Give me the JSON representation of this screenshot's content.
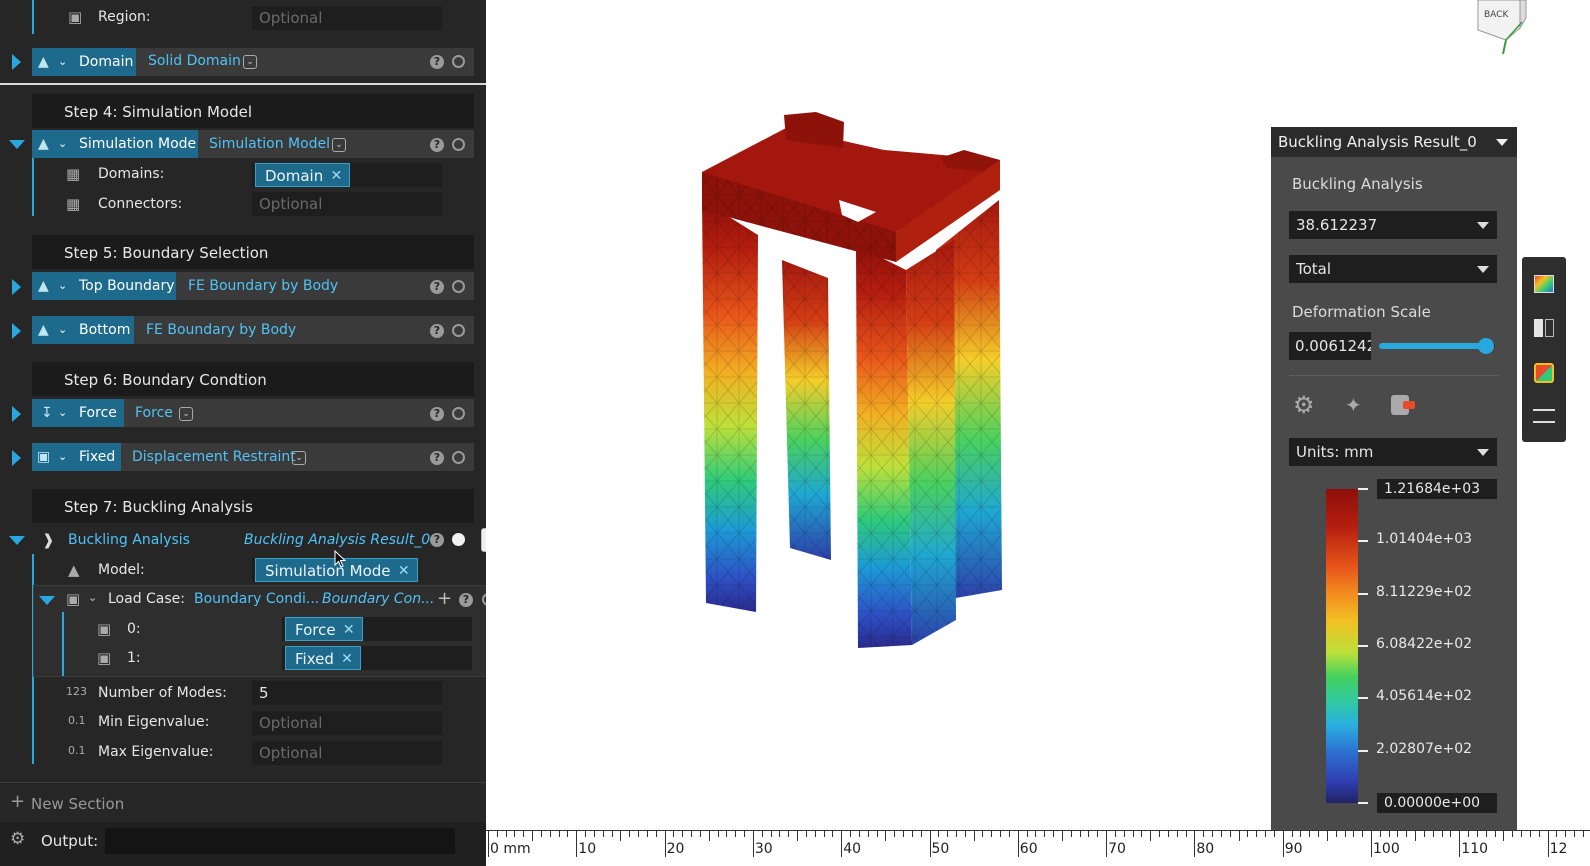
{
  "panel": {
    "region_label": "Region:",
    "region_placeholder": "Optional",
    "domain_node": {
      "title": "Domain",
      "value": "Solid Domain"
    },
    "step4": "Step 4: Simulation Model",
    "sim_node": {
      "title": "Simulation Mode",
      "value": "Simulation Model"
    },
    "domains_label": "Domains:",
    "domains_tag": "Domain",
    "connectors_label": "Connectors:",
    "connectors_placeholder": "Optional",
    "step5": "Step 5: Boundary Selection",
    "top_node": {
      "title": "Top Boundary",
      "value": "FE Boundary by Body"
    },
    "bottom_node": {
      "title": "Bottom",
      "value": "FE Boundary by Body"
    },
    "step6": "Step 6: Boundary Condtion",
    "force_node": {
      "title": "Force",
      "value": "Force"
    },
    "fixed_node": {
      "title": "Fixed",
      "value": "Displacement Restraint"
    },
    "step7": "Step 7: Buckling Analysis",
    "buckling_node": {
      "title": "Buckling Analysis",
      "value": "Buckling Analysis Result_0"
    },
    "model_label": "Model:",
    "model_tag": "Simulation Mode",
    "loadcase_label": "Load Case:",
    "loadcase_value1": "Boundary Condi...",
    "loadcase_value2": "Boundary Con...",
    "lc0_label": "0:",
    "lc0_tag": "Force",
    "lc1_label": "1:",
    "lc1_tag": "Fixed",
    "modes_label": "Number of Modes:",
    "modes_value": "5",
    "min_label": "Min Eigenvalue:",
    "min_placeholder": "Optional",
    "max_label": "Max Eigenvalue:",
    "max_placeholder": "Optional",
    "new_section": "New Section",
    "output_label": "Output:",
    "num_icon_123": "123",
    "num_icon_01": "0.1"
  },
  "viewcube": {
    "label": "BACK"
  },
  "result_panel": {
    "title": "Buckling Analysis Result_0",
    "section": "Buckling Analysis",
    "mode_value": "38.612237",
    "component": "Total",
    "deformation_label": "Deformation Scale",
    "deformation_value": "0.0061242",
    "deformation_fraction": 0.92,
    "units": "Units: mm",
    "colorbar": [
      "1.21684e+03",
      "1.01404e+03",
      "8.11229e+02",
      "6.08422e+02",
      "4.05614e+02",
      "2.02807e+02",
      "0.00000e+00"
    ]
  },
  "ruler": {
    "labels": [
      "0 mm",
      "10",
      "20",
      "30",
      "40",
      "50",
      "60",
      "70",
      "80",
      "90",
      "100",
      "110",
      "12"
    ]
  },
  "colors": {
    "accent": "#29a8e0",
    "tag": "#1e6a8c",
    "panel": "#262626"
  }
}
